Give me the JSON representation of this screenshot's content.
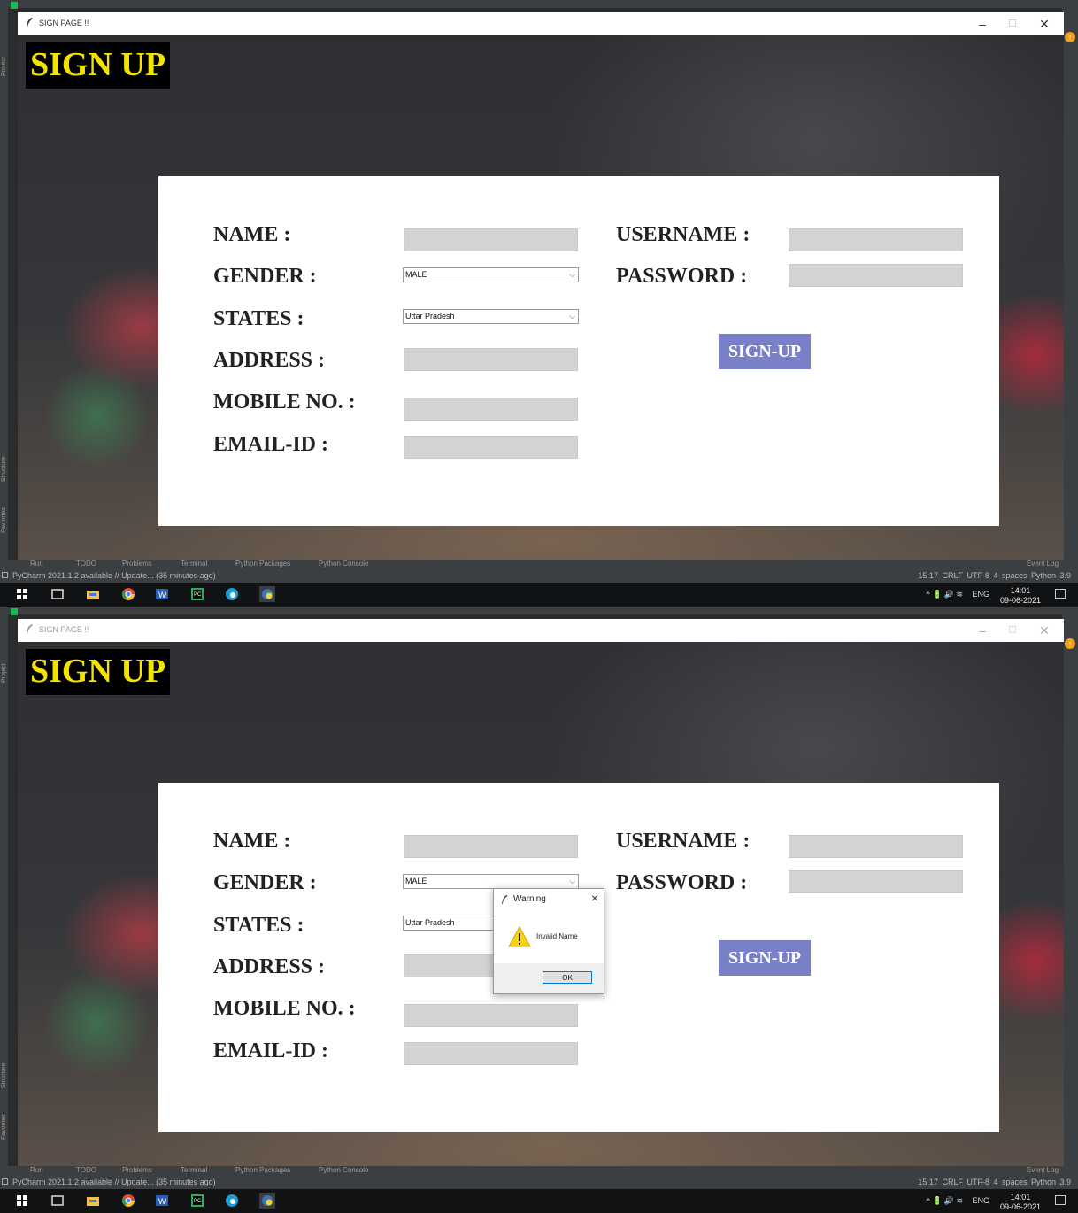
{
  "window": {
    "title": "SIGN PAGE !!"
  },
  "app": {
    "heading": "SIGN UP"
  },
  "form": {
    "name_label": "NAME :",
    "gender_label": "GENDER :",
    "states_label": "STATES :",
    "address_label": "ADDRESS :",
    "mobile_label": "MOBILE NO. :",
    "email_label": "EMAIL-ID :",
    "username_label": "USERNAME :",
    "password_label": "PASSWORD :",
    "gender_value": "MALE",
    "state_value": "Uttar Pradesh",
    "signup_button": "SIGN-UP"
  },
  "dialog": {
    "title": "Warning",
    "message": "Invalid Name",
    "ok_label": "OK"
  },
  "ide": {
    "left_tabs": [
      "Project",
      "Structure",
      "Favorites"
    ],
    "tool_tabs": [
      "Run",
      "TODO",
      "Problems",
      "Terminal",
      "Python Packages",
      "Python Console"
    ],
    "event_log": "Event Log",
    "status_left": "PyCharm 2021.1.2 available // Update... (35 minutes ago)",
    "status_right": "15:17  CRLF  UTF-8  4 spaces  Python 3.9"
  },
  "taskbar": {
    "tray": "ENG",
    "time": "14:01",
    "date": "09-06-2021"
  },
  "colors": {
    "heading_fg": "#f2e400",
    "heading_bg": "#000000",
    "button_bg": "#7a80c8",
    "entry_bg": "#d3d3d3"
  }
}
